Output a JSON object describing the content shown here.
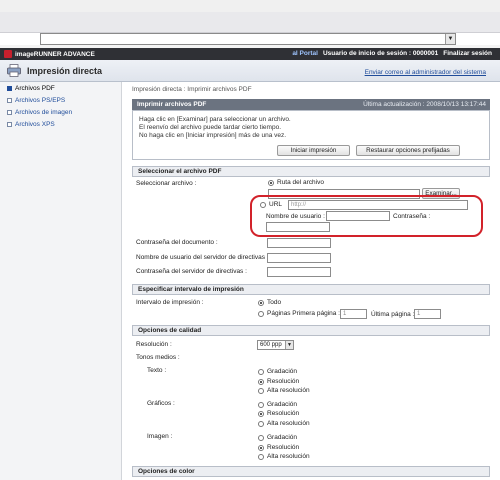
{
  "address": {
    "value": ""
  },
  "header": {
    "logo_text": "imageRUNNER ADVANCE",
    "portal_link": "al Portal",
    "session_label": "Usuario de inicio de sesión : 0000001",
    "logout_label": "Finalizar sesión"
  },
  "titlebar": {
    "title": "Impresión directa",
    "admin_link": "Enviar correo al administrador del sistema"
  },
  "sidebar": {
    "items": [
      {
        "label": "Archivos PDF"
      },
      {
        "label": "Archivos PS/EPS"
      },
      {
        "label": "Archivos de imagen"
      },
      {
        "label": "Archivos XPS"
      }
    ]
  },
  "main": {
    "breadcrumb": "Impresión directa : Imprimir archivos PDF",
    "panel_title": "Imprimir archivos PDF",
    "last_update": "Última actualización : 2008/10/13 13:17:44",
    "info": [
      "Haga clic en [Examinar] para seleccionar un archivo.",
      "El reenvío del archivo puede tardar cierto tiempo.",
      "No haga clic en [Iniciar impresión] más de una vez."
    ],
    "start_button": "Iniciar impresión",
    "restore_button": "Restaurar opciones prefijadas",
    "select_pdf": {
      "heading": "Seleccionar el archivo PDF",
      "select_label": "Seleccionar archivo :",
      "path_option": "Ruta del archivo",
      "browse_button": "Examinar...",
      "url_option": "URL",
      "url_placeholder": "http://",
      "username_label": "Nombre de usuario :",
      "password_label": "Contraseña :",
      "doc_password_label": "Contraseña del documento :",
      "policy_user_label": "Nombre de usuario del servidor de directivas :",
      "policy_password_label": "Contraseña del servidor de directivas :"
    },
    "print_range": {
      "heading": "Especificar intervalo de impresión",
      "label": "Intervalo de impresión :",
      "all_option": "Todo",
      "pages_option": "Páginas Primera página :",
      "first_value": "1",
      "last_label": "Última página :",
      "last_value": "1"
    },
    "quality": {
      "heading": "Opciones de calidad",
      "resolution_label": "Resolución :",
      "resolution_value": "600 ppp",
      "halftones_label": "Tonos medios :",
      "text_label": "Texto :",
      "graphics_label": "Gráficos :",
      "image_label": "Imagen :",
      "opt_gradation": "Gradación",
      "opt_resolution": "Resolución",
      "opt_high": "Alta resolución"
    },
    "color_heading": "Opciones de color"
  },
  "colors": {
    "highlight": "#d2222a",
    "header_bg": "#2f3035",
    "panel_head_bg": "#6b7380",
    "link": "#1f4c9a"
  }
}
